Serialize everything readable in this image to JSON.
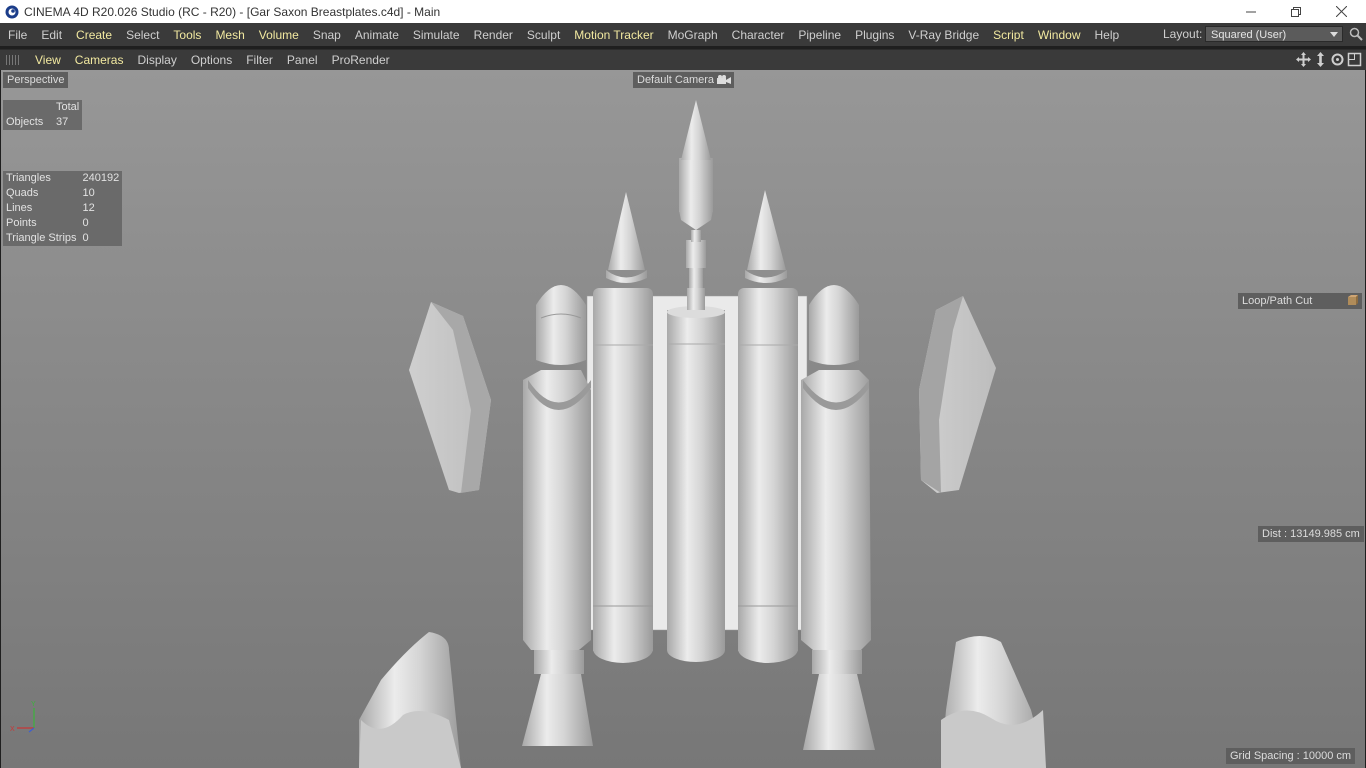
{
  "window": {
    "title": "CINEMA 4D R20.026 Studio (RC - R20) - [Gar Saxon Breastplates.c4d] - Main"
  },
  "menu": {
    "items": [
      {
        "label": "File",
        "highlight": false
      },
      {
        "label": "Edit",
        "highlight": false
      },
      {
        "label": "Create",
        "highlight": true
      },
      {
        "label": "Select",
        "highlight": false
      },
      {
        "label": "Tools",
        "highlight": true
      },
      {
        "label": "Mesh",
        "highlight": true
      },
      {
        "label": "Volume",
        "highlight": true
      },
      {
        "label": "Snap",
        "highlight": false
      },
      {
        "label": "Animate",
        "highlight": false
      },
      {
        "label": "Simulate",
        "highlight": false
      },
      {
        "label": "Render",
        "highlight": false
      },
      {
        "label": "Sculpt",
        "highlight": false
      },
      {
        "label": "Motion Tracker",
        "highlight": true
      },
      {
        "label": "MoGraph",
        "highlight": false
      },
      {
        "label": "Character",
        "highlight": false
      },
      {
        "label": "Pipeline",
        "highlight": false
      },
      {
        "label": "Plugins",
        "highlight": false
      },
      {
        "label": "V-Ray Bridge",
        "highlight": false
      },
      {
        "label": "Script",
        "highlight": true
      },
      {
        "label": "Window",
        "highlight": true
      },
      {
        "label": "Help",
        "highlight": false
      }
    ],
    "layout_label": "Layout:",
    "layout_value": "Squared (User)"
  },
  "viewmenu": {
    "items": [
      {
        "label": "View",
        "highlight": true
      },
      {
        "label": "Cameras",
        "highlight": true
      },
      {
        "label": "Display",
        "highlight": false
      },
      {
        "label": "Options",
        "highlight": false
      },
      {
        "label": "Filter",
        "highlight": false
      },
      {
        "label": "Panel",
        "highlight": false
      },
      {
        "label": "ProRender",
        "highlight": false
      }
    ]
  },
  "viewport": {
    "projection": "Perspective",
    "camera": "Default Camera",
    "tool": "Loop/Path Cut",
    "distance": "Dist : 13149.985 cm",
    "grid_spacing": "Grid Spacing : 10000 cm",
    "stats_objects": {
      "header": "Total",
      "label": "Objects",
      "value": "37"
    },
    "stats_polys": [
      {
        "label": "Triangles",
        "value": "240192"
      },
      {
        "label": "Quads",
        "value": "10"
      },
      {
        "label": "Lines",
        "value": "12"
      },
      {
        "label": "Points",
        "value": "0"
      },
      {
        "label": "Triangle Strips",
        "value": "0"
      }
    ]
  },
  "colors": {
    "menu_highlight": "#f2e9a0",
    "ui_dark": "#3a3a3a",
    "viewport_bg": "#8a8a8a"
  }
}
